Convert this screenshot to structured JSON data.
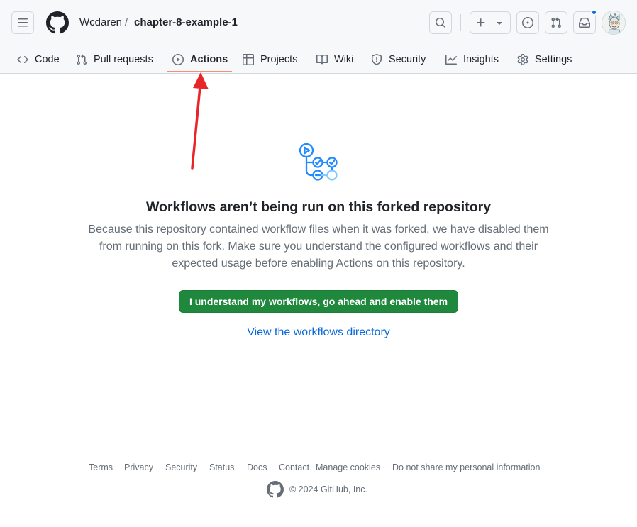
{
  "header": {
    "owner": "Wcdaren",
    "separator": "/",
    "repo": "chapter-8-example-1",
    "icons": {
      "menu": "hamburger-icon",
      "logo": "github-logo-icon",
      "search": "search-icon",
      "create": "plus-icon",
      "issues": "issue-opened-icon",
      "pulls": "git-pull-request-icon",
      "inbox": "inbox-icon"
    },
    "notification_color": "#0969da"
  },
  "tabs": [
    {
      "label": "Code",
      "icon": "code-icon"
    },
    {
      "label": "Pull requests",
      "icon": "git-pull-request-icon"
    },
    {
      "label": "Actions",
      "icon": "play-icon",
      "active": true
    },
    {
      "label": "Projects",
      "icon": "table-icon"
    },
    {
      "label": "Wiki",
      "icon": "book-icon"
    },
    {
      "label": "Security",
      "icon": "shield-icon"
    },
    {
      "label": "Insights",
      "icon": "graph-icon"
    },
    {
      "label": "Settings",
      "icon": "gear-icon"
    }
  ],
  "main": {
    "title": "Workflows aren’t being run on this forked repository",
    "description_lines": [
      "Because this repository contained workflow files when it was forked, we have disabled them",
      "from running on this fork. Make sure you understand the configured workflows and their",
      "expected usage before enabling Actions on this repository."
    ],
    "enable_button": "I understand my workflows, go ahead and enable them",
    "directory_link": "View the workflows directory",
    "accent_colors": {
      "primary_button": "#1f883d",
      "link": "#0969da",
      "tab_underline": "#fd8c73",
      "annotation_arrow": "#e8262a"
    }
  },
  "footer": {
    "links": [
      "Terms",
      "Privacy",
      "Security",
      "Status",
      "Docs",
      "Contact",
      "Manage cookies",
      "Do not share my personal information"
    ],
    "copyright": "© 2024 GitHub, Inc."
  }
}
